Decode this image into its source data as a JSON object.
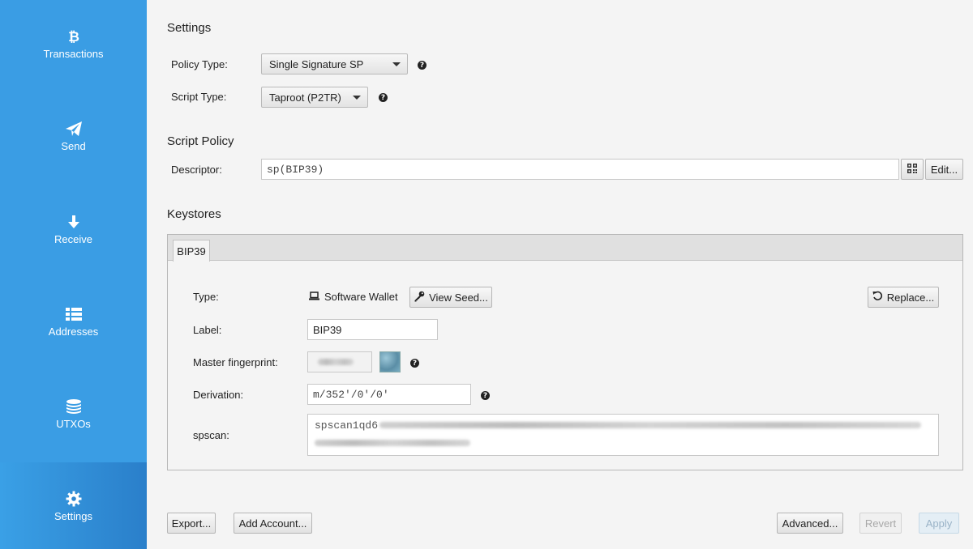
{
  "sidebar": {
    "items": [
      {
        "label": "Transactions",
        "icon": "bitcoin-icon"
      },
      {
        "label": "Send",
        "icon": "paper-plane-icon"
      },
      {
        "label": "Receive",
        "icon": "arrow-down-icon"
      },
      {
        "label": "Addresses",
        "icon": "list-icon"
      },
      {
        "label": "UTXOs",
        "icon": "coins-icon"
      },
      {
        "label": "Settings",
        "icon": "gear-icon",
        "active": true
      }
    ],
    "bg_color": "#3a9de4"
  },
  "settings": {
    "title": "Settings",
    "policy_type_label": "Policy Type:",
    "policy_type_value": "Single Signature SP",
    "script_type_label": "Script Type:",
    "script_type_value": "Taproot (P2TR)"
  },
  "script_policy": {
    "title": "Script Policy",
    "descriptor_label": "Descriptor:",
    "descriptor_value": "sp(BIP39)",
    "edit_label": "Edit..."
  },
  "keystores": {
    "title": "Keystores",
    "tab_label": "BIP39",
    "type_label": "Type:",
    "type_value": "Software Wallet",
    "view_seed_label": "View Seed...",
    "replace_label": "Replace...",
    "label_label": "Label:",
    "label_value": "BIP39",
    "fingerprint_label": "Master fingerprint:",
    "derivation_label": "Derivation:",
    "derivation_value": "m/352'/0'/0'",
    "spscan_label": "spscan:",
    "spscan_value": "spscan1qd6"
  },
  "footer": {
    "export_label": "Export...",
    "add_account_label": "Add Account...",
    "advanced_label": "Advanced...",
    "revert_label": "Revert",
    "apply_label": "Apply"
  }
}
